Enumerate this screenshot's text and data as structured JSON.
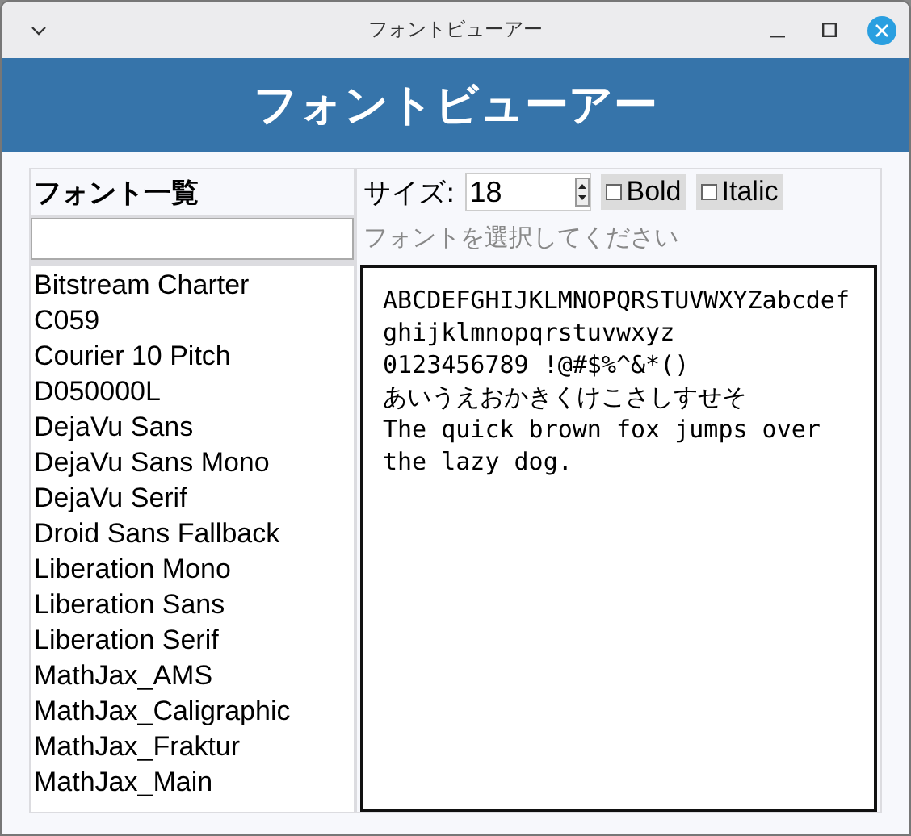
{
  "window": {
    "title": "フォントビューアー"
  },
  "header": {
    "title": "フォントビューアー"
  },
  "font_list": {
    "title": "フォント一覧",
    "items": [
      {
        "label": "Bitstream Charter",
        "selected": false
      },
      {
        "label": "C059",
        "selected": false
      },
      {
        "label": "Courier 10 Pitch",
        "selected": false
      },
      {
        "label": "D050000L",
        "selected": false
      },
      {
        "label": "DejaVu Sans",
        "selected": false
      },
      {
        "label": "DejaVu Sans Mono",
        "selected": false
      },
      {
        "label": "DejaVu Serif",
        "selected": false
      },
      {
        "label": "Droid Sans Fallback",
        "selected": false
      },
      {
        "label": "Liberation Mono",
        "selected": false
      },
      {
        "label": "Liberation Sans",
        "selected": false
      },
      {
        "label": "Liberation Serif",
        "selected": false
      },
      {
        "label": "MathJax_AMS",
        "selected": false
      },
      {
        "label": "MathJax_Caligraphic",
        "selected": false
      },
      {
        "label": "MathJax_Fraktur",
        "selected": false
      },
      {
        "label": "MathJax_Main",
        "selected": false
      }
    ]
  },
  "controls": {
    "size_label": "サイズ:",
    "size": "18",
    "bold": {
      "label": "Bold",
      "checked": false
    },
    "italic": {
      "label": "Italic",
      "checked": false
    }
  },
  "status": "フォントを選択してください",
  "preview": {
    "lines": [
      "ABCDEFGHIJKLMNOPQRSTUVWXYZabcdefghijklmnopqrstuvwxyz",
      "0123456789 !@#$%^&*()",
      "あいうえおかきくけこさしすせそ",
      "The quick brown fox jumps over the lazy dog."
    ]
  }
}
